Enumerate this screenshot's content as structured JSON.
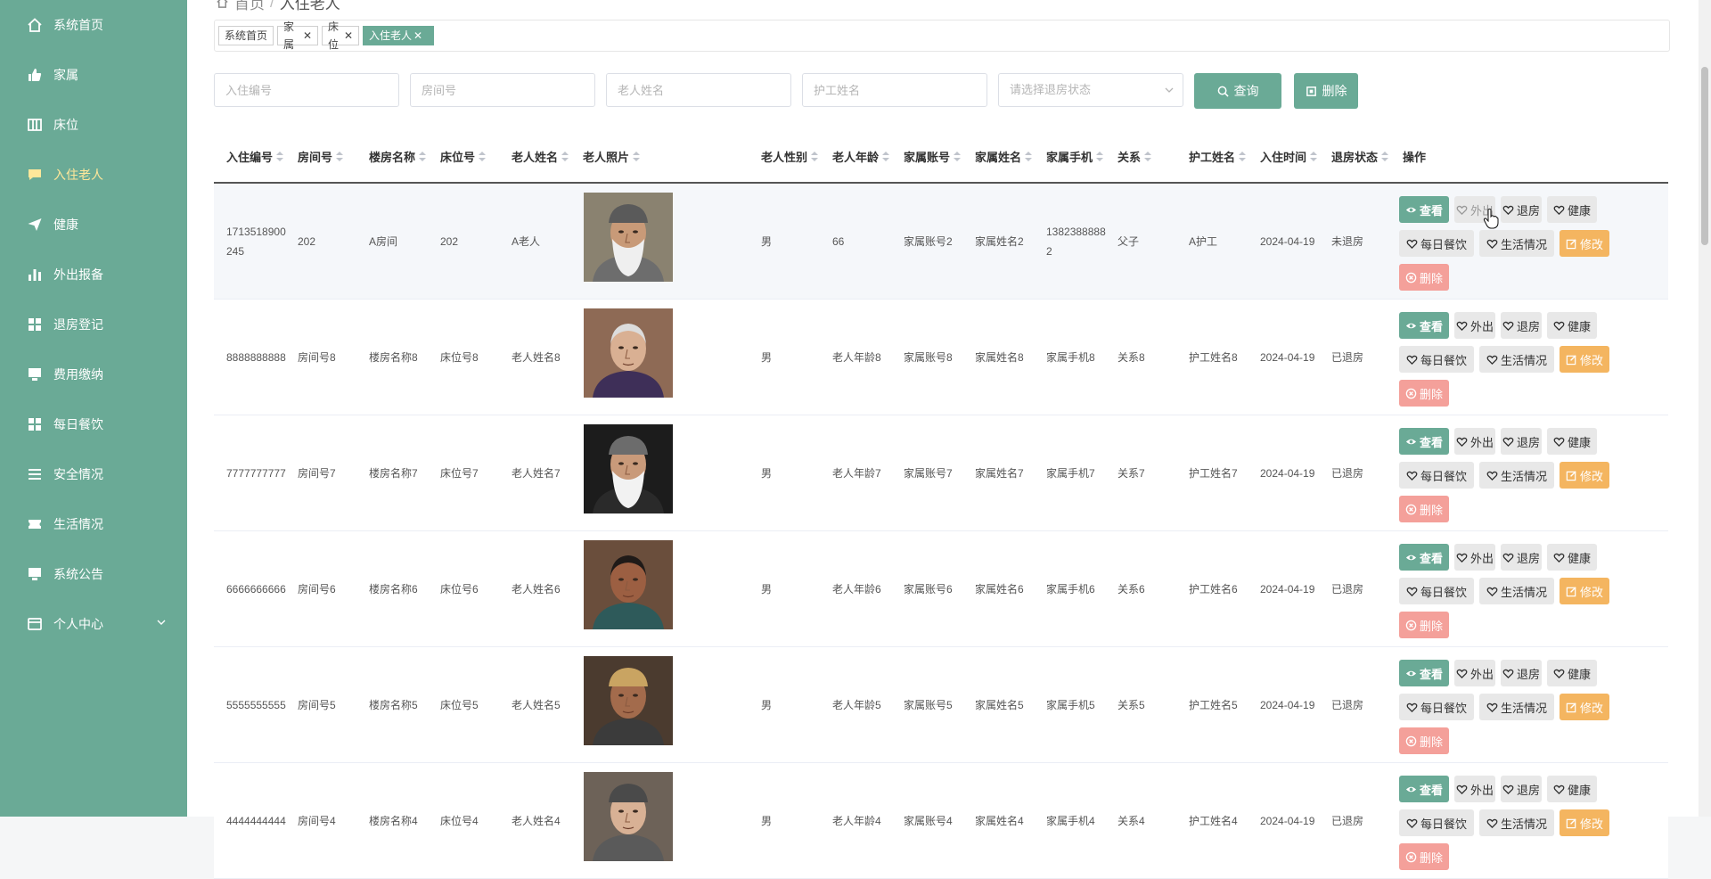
{
  "sidebar": {
    "items": [
      {
        "label": "系统首页",
        "icon": "home-icon"
      },
      {
        "label": "家属",
        "icon": "thumb-icon"
      },
      {
        "label": "床位",
        "icon": "columns-icon"
      },
      {
        "label": "入住老人",
        "icon": "chat-icon",
        "active": true
      },
      {
        "label": "健康",
        "icon": "send-icon"
      },
      {
        "label": "外出报备",
        "icon": "bar-chart-icon"
      },
      {
        "label": "退房登记",
        "icon": "grid-icon"
      },
      {
        "label": "费用缴纳",
        "icon": "monitor-icon"
      },
      {
        "label": "每日餐饮",
        "icon": "grid-icon"
      },
      {
        "label": "安全情况",
        "icon": "list-icon"
      },
      {
        "label": "生活情况",
        "icon": "ticket-icon"
      },
      {
        "label": "系统公告",
        "icon": "monitor-icon"
      },
      {
        "label": "个人中心",
        "icon": "card-icon",
        "expandable": true
      }
    ]
  },
  "breadcrumb": {
    "home": "首页",
    "separator": "/",
    "current": "入住老人"
  },
  "tags": [
    {
      "label": "系统首页",
      "closable": false
    },
    {
      "label": "家属",
      "closable": true
    },
    {
      "label": "床位",
      "closable": true
    },
    {
      "label": "入住老人",
      "closable": true,
      "active": true
    }
  ],
  "search": {
    "checkin_no_placeholder": "入住编号",
    "room_no_placeholder": "房间号",
    "elder_name_placeholder": "老人姓名",
    "nurse_name_placeholder": "护工姓名",
    "checkout_status_placeholder": "请选择退房状态",
    "query_label": "查询",
    "delete_label": "删除"
  },
  "table": {
    "headers": [
      "入住编号",
      "房间号",
      "楼房名称",
      "床位号",
      "老人姓名",
      "老人照片",
      "老人性别",
      "老人年龄",
      "家属账号",
      "家属姓名",
      "家属手机",
      "关系",
      "护工姓名",
      "入住时间",
      "退房状态",
      "操作"
    ],
    "actions": {
      "view": "查看",
      "out": "外出",
      "checkout": "退房",
      "health": "健康",
      "meal": "每日餐饮",
      "life": "生活情况",
      "edit": "修改",
      "delete": "删除"
    },
    "rows": [
      {
        "checkin_no_1": "1713518900",
        "checkin_no_2": "245",
        "room": "202",
        "building": "A房间",
        "bed": "202",
        "name": "A老人",
        "gender": "男",
        "age": "66",
        "family_account": "家属账号2",
        "family_name": "家属姓名2",
        "phone_1": "1382388888",
        "phone_2": "2",
        "relation": "父子",
        "nurse": "A护工",
        "date": "2024-04-19",
        "status": "未退房"
      },
      {
        "checkin_no_1": "8888888888",
        "checkin_no_2": "",
        "room": "房间号8",
        "building": "楼房名称8",
        "bed": "床位号8",
        "name": "老人姓名8",
        "gender": "男",
        "age": "老人年龄8",
        "family_account": "家属账号8",
        "family_name": "家属姓名8",
        "phone_1": "家属手机8",
        "phone_2": "",
        "relation": "关系8",
        "nurse": "护工姓名8",
        "date": "2024-04-19",
        "status": "已退房"
      },
      {
        "checkin_no_1": "7777777777",
        "checkin_no_2": "",
        "room": "房间号7",
        "building": "楼房名称7",
        "bed": "床位号7",
        "name": "老人姓名7",
        "gender": "男",
        "age": "老人年龄7",
        "family_account": "家属账号7",
        "family_name": "家属姓名7",
        "phone_1": "家属手机7",
        "phone_2": "",
        "relation": "关系7",
        "nurse": "护工姓名7",
        "date": "2024-04-19",
        "status": "已退房"
      },
      {
        "checkin_no_1": "6666666666",
        "checkin_no_2": "",
        "room": "房间号6",
        "building": "楼房名称6",
        "bed": "床位号6",
        "name": "老人姓名6",
        "gender": "男",
        "age": "老人年龄6",
        "family_account": "家属账号6",
        "family_name": "家属姓名6",
        "phone_1": "家属手机6",
        "phone_2": "",
        "relation": "关系6",
        "nurse": "护工姓名6",
        "date": "2024-04-19",
        "status": "已退房"
      },
      {
        "checkin_no_1": "5555555555",
        "checkin_no_2": "",
        "room": "房间号5",
        "building": "楼房名称5",
        "bed": "床位号5",
        "name": "老人姓名5",
        "gender": "男",
        "age": "老人年龄5",
        "family_account": "家属账号5",
        "family_name": "家属姓名5",
        "phone_1": "家属手机5",
        "phone_2": "",
        "relation": "关系5",
        "nurse": "护工姓名5",
        "date": "2024-04-19",
        "status": "已退房"
      },
      {
        "checkin_no_1": "4444444444",
        "checkin_no_2": "",
        "room": "房间号4",
        "building": "楼房名称4",
        "bed": "床位号4",
        "name": "老人姓名4",
        "gender": "男",
        "age": "老人年龄4",
        "family_account": "家属账号4",
        "family_name": "家属姓名4",
        "phone_1": "家属手机4",
        "phone_2": "",
        "relation": "关系4",
        "nurse": "护工姓名4",
        "date": "2024-04-19",
        "status": "已退房"
      }
    ]
  },
  "colors": {
    "sidebar": "#6aaa96",
    "active_nav": "#ffe79a",
    "primary": "#6aaa96",
    "edit": "#f4b560",
    "delete": "#f4a09a"
  }
}
